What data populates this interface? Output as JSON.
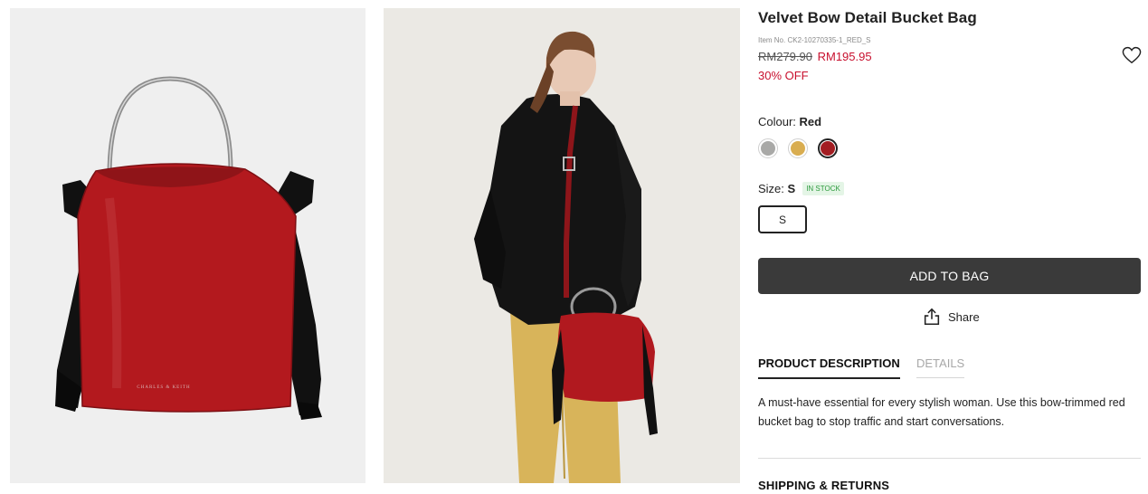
{
  "product": {
    "title": "Velvet Bow Detail Bucket Bag",
    "item_no": "Item No. CK2-10270335-1_RED_S",
    "price_original": "RM279.90",
    "price_sale": "RM195.95",
    "discount": "30% OFF",
    "brand_logo_text": "CHARLES & KEITH"
  },
  "colour": {
    "label": "Colour:",
    "selected": "Red",
    "options": [
      {
        "name": "grey",
        "color": "#a9a9a7"
      },
      {
        "name": "yellow",
        "color": "#d9ad50"
      },
      {
        "name": "red",
        "color": "#a31d22"
      }
    ]
  },
  "size": {
    "label": "Size:",
    "selected": "S",
    "stock": "IN STOCK",
    "option": "S"
  },
  "actions": {
    "add_to_bag": "ADD TO BAG",
    "share": "Share"
  },
  "tabs": {
    "description": "PRODUCT DESCRIPTION",
    "details": "DETAILS"
  },
  "description": "A must-have essential for every stylish woman. Use this bow-trimmed red bucket bag to stop traffic and start conversations.",
  "shipping": "SHIPPING & RETURNS",
  "icons": {
    "wishlist": "heart-outline-icon",
    "share": "share-upload-icon"
  },
  "colors": {
    "sale_red": "#c8102e",
    "button_dark": "#3a3a3a",
    "stock_green": "#2e9b3e"
  }
}
